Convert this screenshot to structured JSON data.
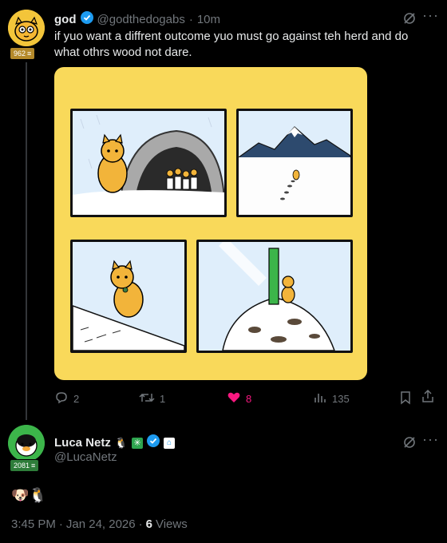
{
  "tweet": {
    "author_name": "god",
    "handle": "@godthedogabs",
    "separator": "·",
    "time": "10m",
    "badge_count": "962",
    "text": "if yuo want a diffrent outcome yuo must go against teh herd and do what othrs wood not dare.",
    "replies": "2",
    "retweets": "1",
    "likes": "8",
    "views": "135",
    "colors": {
      "like": "#f91880",
      "verified": "#1d9bf0",
      "comic_bg": "#f9d95a"
    }
  },
  "reply": {
    "author_name": "Luca Netz",
    "handle": "@LucaNetz",
    "badge_count": "2081",
    "text_emojis": "🐶🐧",
    "time": "3:45 PM",
    "date": "Jan 24, 2026",
    "separator": "·",
    "views_count": "6",
    "views_label": "Views",
    "name_emojis": "🐧"
  }
}
